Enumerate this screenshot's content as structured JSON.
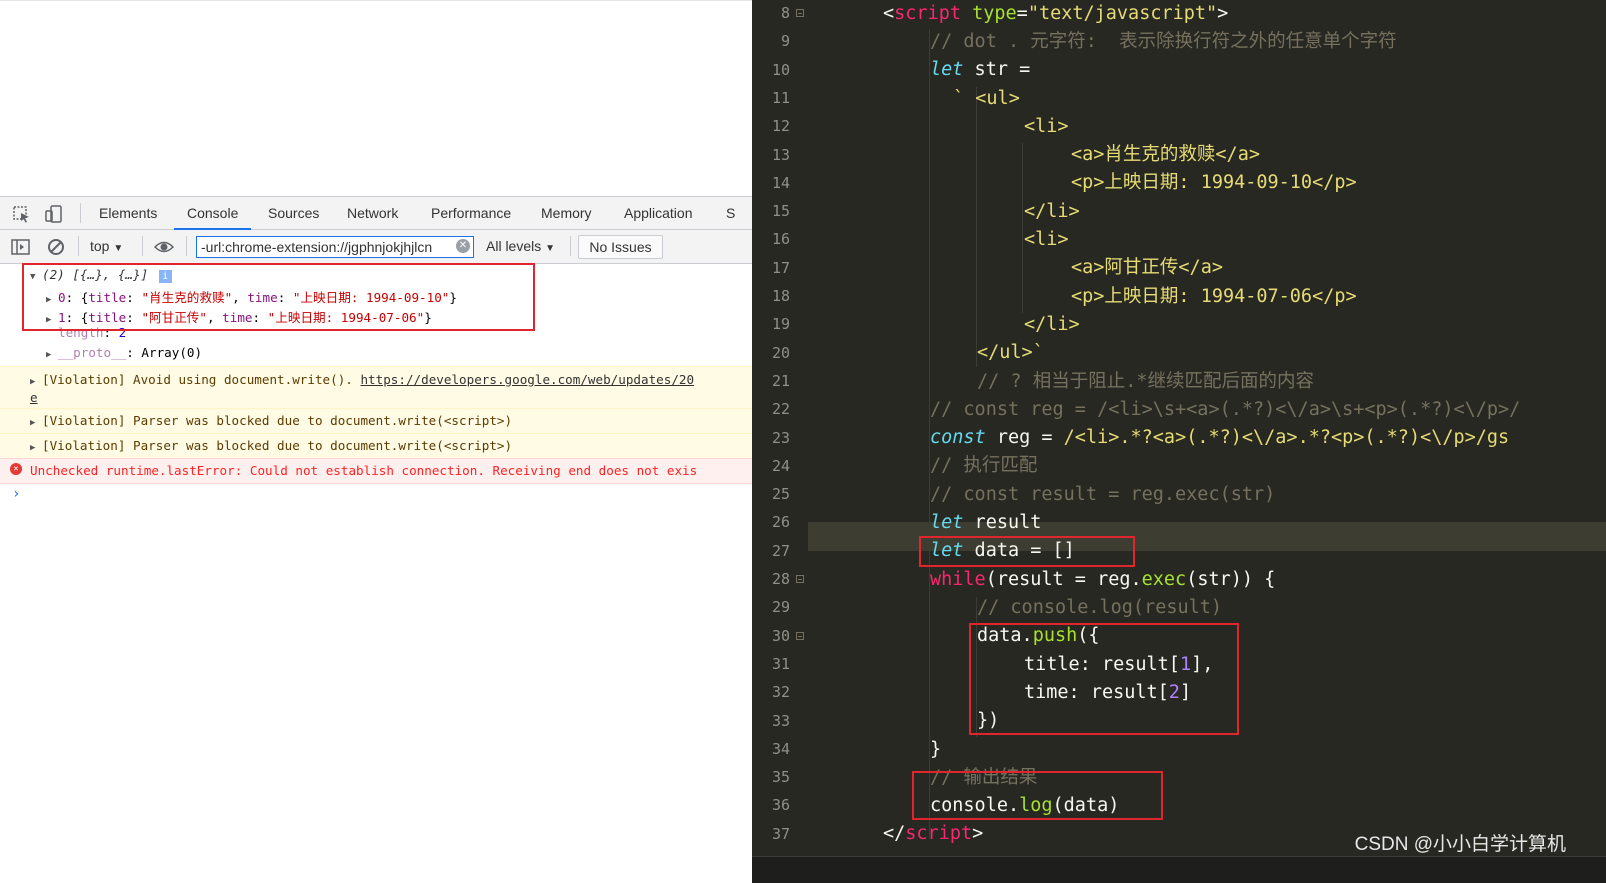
{
  "devtools": {
    "tabs": [
      "Elements",
      "Console",
      "Sources",
      "Network",
      "Performance",
      "Memory",
      "Application",
      "S"
    ],
    "active_tab": "Console",
    "context": "top",
    "filter_value": "-url:chrome-extension://jgphnjokjhjlcn",
    "levels": "All levels",
    "issues": "No Issues"
  },
  "console": {
    "array_summary": "(2) [{…}, {…}]",
    "info_badge": "i",
    "items": [
      {
        "index": "0",
        "title": "\"肖生克的救赎\"",
        "time": "\"上映日期: 1994-09-10\""
      },
      {
        "index": "1",
        "title": "\"阿甘正传\"",
        "time": "\"上映日期: 1994-07-06\""
      }
    ],
    "length_key": "length",
    "length_value": "2",
    "proto_key": "__proto__",
    "proto_value": "Array(0)",
    "violation_1": "[Violation] Avoid using document.write().",
    "violation_1_link": "https://developers.google.com/web/updates/20",
    "violation_1_wrap": "e",
    "violation_2": "[Violation] Parser was blocked due to document.write(<script>)",
    "violation_3": "[Violation] Parser was blocked due to document.write(<script>)",
    "error": "Unchecked runtime.lastError: Could not establish connection. Receiving end does not exis",
    "prompt": "›"
  },
  "editor": {
    "line_numbers": [
      "8",
      "9",
      "10",
      "11",
      "12",
      "13",
      "14",
      "15",
      "16",
      "17",
      "18",
      "19",
      "20",
      "21",
      "22",
      "23",
      "24",
      "25",
      "26",
      "27",
      "28",
      "29",
      "30",
      "31",
      "32",
      "33",
      "34",
      "35",
      "36",
      "37"
    ],
    "lines": {
      "l8_a": "<",
      "l8_tag": "script",
      "l8_attr": " type",
      "l8_eq": "=",
      "l8_str": "\"text/javascript\"",
      "l8_b": ">",
      "l9": "// dot . 元字符:  表示除换行符之外的任意单个字符",
      "l10_kw": "let",
      "l10_rest": " str =",
      "l11": "` <ul>",
      "l12": "<li>",
      "l13": "<a>肖生克的救赎</a>",
      "l14": "<p>上映日期: 1994-09-10</p>",
      "l15": "</li>",
      "l16": "<li>",
      "l17": "<a>阿甘正传</a>",
      "l18": "<p>上映日期: 1994-07-06</p>",
      "l19": "</li>",
      "l20": "</ul>`",
      "l21": "// ? 相当于阻止.*继续匹配后面的内容",
      "l22": "// const reg = /<li>\\s+<a>(.*?)<\\/a>\\s+<p>(.*?)<\\/p>/",
      "l23_kw": "const",
      "l23_rest": " reg = ",
      "l23_re": "/<li>.*?<a>(.*?)<\\/a>.*?<p>(.*?)<\\/p>/gs",
      "l24": "// 执行匹配",
      "l25": "// const result = reg.exec(str)",
      "l26_kw": "let",
      "l26_rest": " result",
      "l27_kw": "let",
      "l27_rest": " data = []",
      "l28_ctl": "while",
      "l28_a": "(result = reg.",
      "l28_fn": "exec",
      "l28_b": "(str)) {",
      "l29": "// console.log(result)",
      "l30_a": "data.",
      "l30_fn": "push",
      "l30_b": "({",
      "l31_a": "title: result[",
      "l31_num": "1",
      "l31_b": "],",
      "l32_a": "time: result[",
      "l32_num": "2",
      "l32_b": "]",
      "l33": "})",
      "l34": "}",
      "l35": "// 输出结果",
      "l36_a": "console.",
      "l36_fn": "log",
      "l36_b": "(data)",
      "l37_a": "</",
      "l37_tag": "script",
      "l37_b": ">"
    },
    "watermark": "CSDN @小小白学计算机"
  }
}
